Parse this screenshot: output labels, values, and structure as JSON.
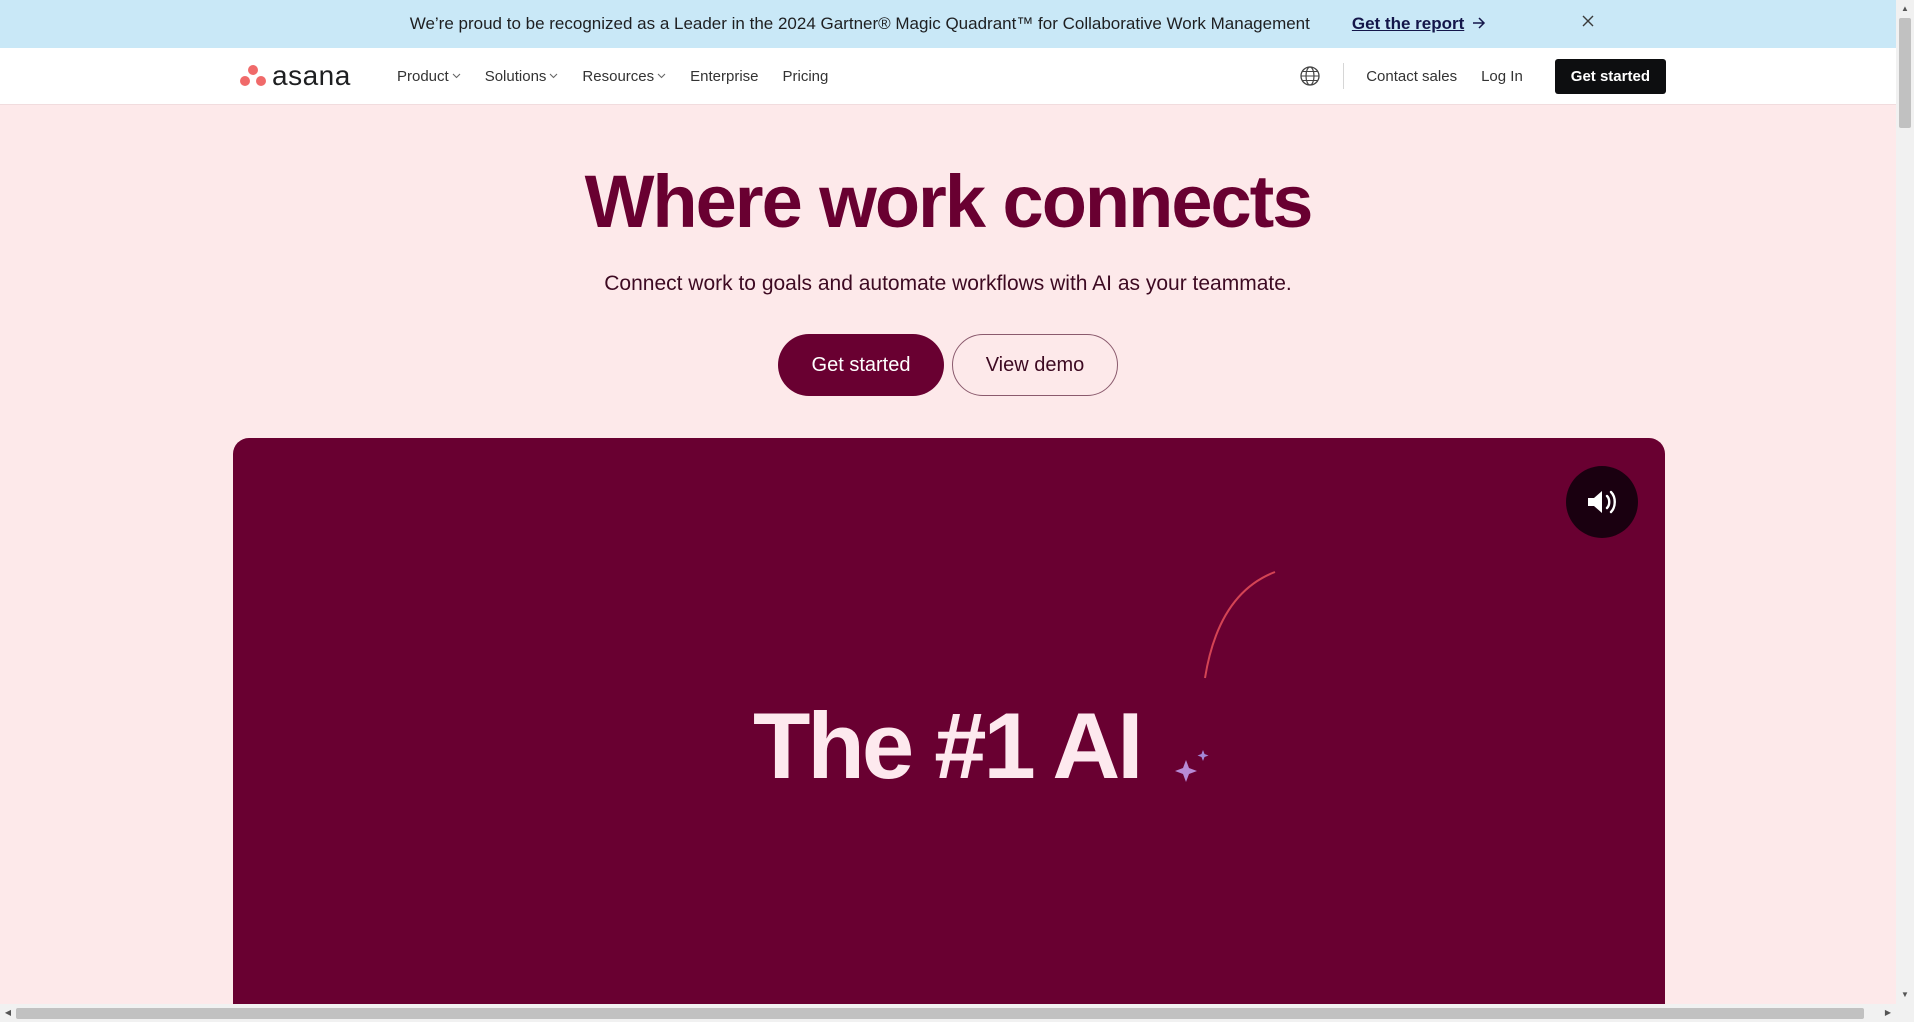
{
  "banner": {
    "message": "We’re proud to be recognized as a Leader in the 2024 Gartner® Magic Quadrant™ for Collaborative Work Management",
    "link_label": "Get the report",
    "link_icon": "arrow-right-icon",
    "close_icon": "close-icon"
  },
  "nav": {
    "logo_text": "asana",
    "items": [
      {
        "label": "Product",
        "has_dropdown": true
      },
      {
        "label": "Solutions",
        "has_dropdown": true
      },
      {
        "label": "Resources",
        "has_dropdown": true
      },
      {
        "label": "Enterprise",
        "has_dropdown": false
      },
      {
        "label": "Pricing",
        "has_dropdown": false
      }
    ],
    "language_icon": "globe-icon",
    "contact_label": "Contact sales",
    "login_label": "Log In",
    "cta_label": "Get started"
  },
  "hero": {
    "title": "Where work connects",
    "subtitle": "Connect work to goals and automate workflows with AI as your teammate.",
    "primary_button": "Get started",
    "secondary_button": "View demo"
  },
  "video": {
    "text": "The #1 AI",
    "sound_icon": "volume-icon",
    "background": "#690031"
  },
  "colors": {
    "brand": "#690031",
    "banner_bg": "#c9e8f7",
    "page_bg": "#fde9ea",
    "logo": "#f06a6a"
  }
}
